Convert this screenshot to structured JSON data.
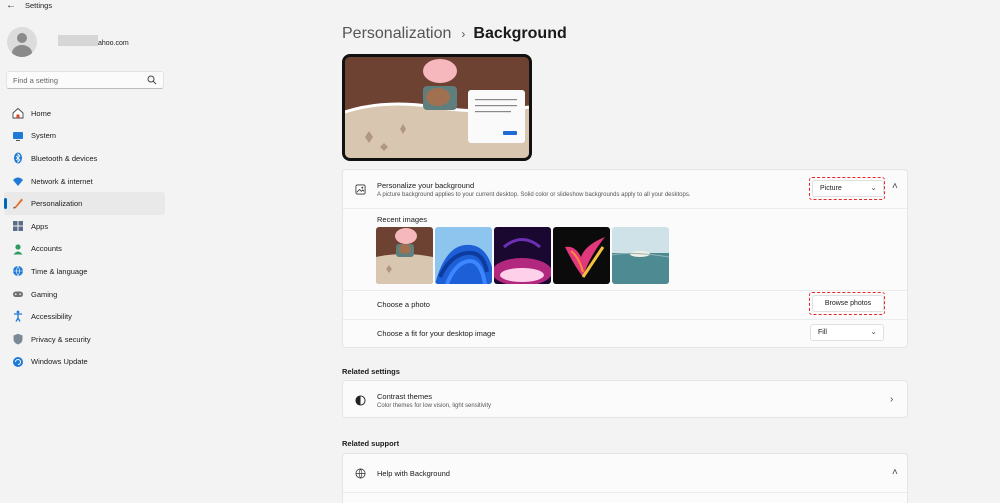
{
  "window": {
    "title": "Settings",
    "back_icon": "back-arrow-icon"
  },
  "profile": {
    "email_visible": "ahoo.com"
  },
  "search": {
    "placeholder": "Find a setting",
    "icon": "search-icon"
  },
  "sidebar": {
    "items": [
      {
        "label": "Home",
        "icon": "home-icon",
        "active": false
      },
      {
        "label": "System",
        "icon": "system-icon",
        "active": false
      },
      {
        "label": "Bluetooth & devices",
        "icon": "bluetooth-icon",
        "active": false
      },
      {
        "label": "Network & internet",
        "icon": "network-icon",
        "active": false
      },
      {
        "label": "Personalization",
        "icon": "personalization-icon",
        "active": true
      },
      {
        "label": "Apps",
        "icon": "apps-icon",
        "active": false
      },
      {
        "label": "Accounts",
        "icon": "accounts-icon",
        "active": false
      },
      {
        "label": "Time & language",
        "icon": "time-language-icon",
        "active": false
      },
      {
        "label": "Gaming",
        "icon": "gaming-icon",
        "active": false
      },
      {
        "label": "Accessibility",
        "icon": "accessibility-icon",
        "active": false
      },
      {
        "label": "Privacy & security",
        "icon": "privacy-icon",
        "active": false
      },
      {
        "label": "Windows Update",
        "icon": "windows-update-icon",
        "active": false
      }
    ]
  },
  "breadcrumb": {
    "parent": "Personalization",
    "separator": "›",
    "current": "Background"
  },
  "background": {
    "title": "Personalize your background",
    "subtitle": "A picture background applies to your current desktop. Solid color or slideshow backgrounds apply to all your desktops.",
    "type_value": "Picture",
    "recent_images_label": "Recent images",
    "choose_photo_label": "Choose a photo",
    "browse_label": "Browse photos",
    "fit_label": "Choose a fit for your desktop image",
    "fit_value": "Fill"
  },
  "related_settings": {
    "heading": "Related settings",
    "contrast_title": "Contrast themes",
    "contrast_sub": "Color themes for low vision, light sensitivity"
  },
  "related_support": {
    "heading": "Related support",
    "help_title": "Help with Background"
  },
  "colors": {
    "accent": "#0067c0",
    "highlight": "#e8272b"
  }
}
